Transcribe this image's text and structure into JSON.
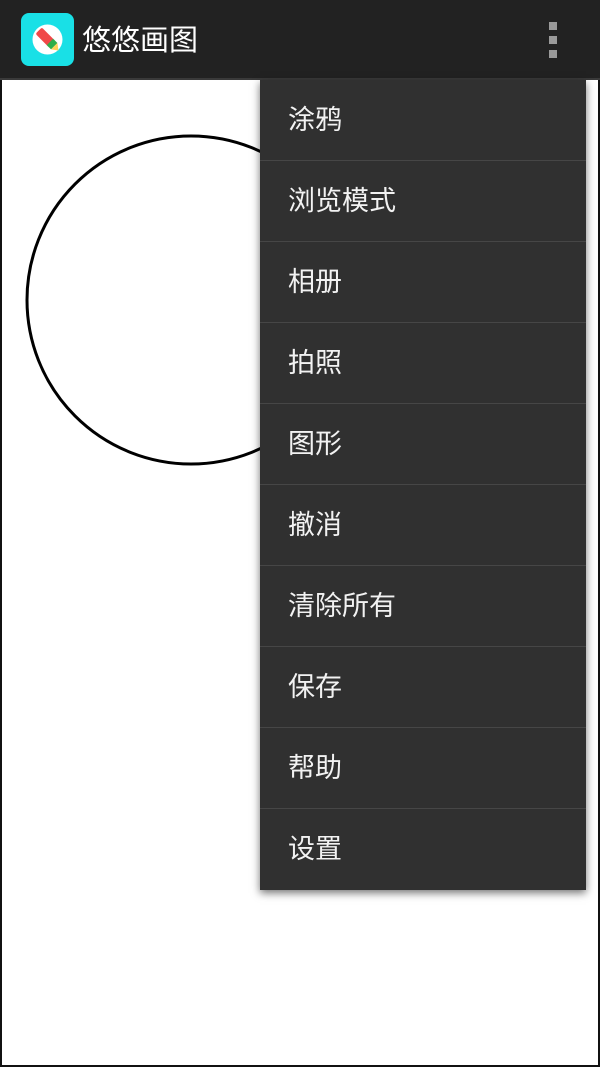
{
  "action_bar": {
    "title": "悠悠画图",
    "icon": "paint-brush-app-icon",
    "overflow_icon": "more-vert-icon"
  },
  "colors": {
    "action_bar_bg": "#222222",
    "menu_bg": "#303030",
    "app_icon_bg": "#19e0e6",
    "canvas_bg": "#ffffff",
    "stroke": "#000000"
  },
  "canvas": {
    "shape": "circle"
  },
  "overflow_menu": {
    "items": [
      {
        "label": "涂鸦"
      },
      {
        "label": "浏览模式"
      },
      {
        "label": "相册"
      },
      {
        "label": "拍照"
      },
      {
        "label": "图形"
      },
      {
        "label": "撤消"
      },
      {
        "label": "清除所有"
      },
      {
        "label": "保存"
      },
      {
        "label": "帮助"
      },
      {
        "label": "设置"
      }
    ]
  }
}
